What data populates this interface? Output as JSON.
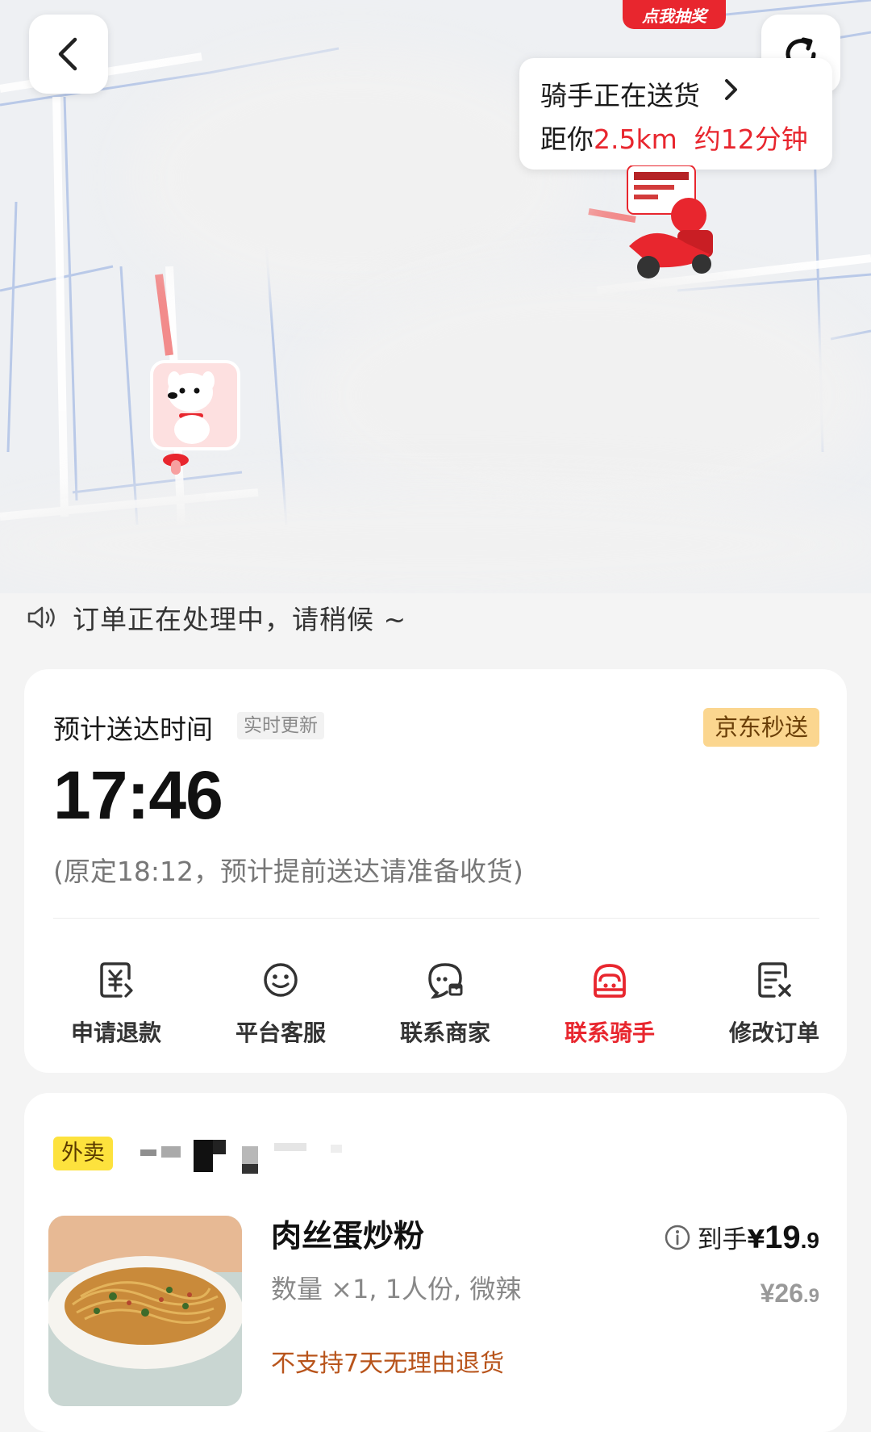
{
  "map": {
    "lottery_badge": "点我抽奖",
    "rider_bubble": {
      "status": "骑手正在送货",
      "distance_prefix": "距你",
      "distance": "2.5km",
      "eta_text": "约12分钟"
    }
  },
  "notice": {
    "text": "订单正在处理中，请稍候 ~"
  },
  "delivery": {
    "eta_label": "预计送达时间",
    "realtime_tag": "实时更新",
    "brand_tag": "京东秒送",
    "eta_time": "17:46",
    "eta_note": "(原定18:12，预计提前送达请准备收货)",
    "actions": [
      {
        "label": "申请退款",
        "icon": "refund-icon"
      },
      {
        "label": "平台客服",
        "icon": "customer-service-icon"
      },
      {
        "label": "联系商家",
        "icon": "contact-merchant-icon"
      },
      {
        "label": "联系骑手",
        "icon": "contact-rider-icon",
        "active": true
      },
      {
        "label": "修改订单",
        "icon": "edit-order-icon"
      }
    ]
  },
  "order": {
    "tag": "外卖",
    "item": {
      "name": "肉丝蛋炒粉",
      "spec": "数量 ×1, 1人份, 微辣",
      "policy": "不支持7天无理由退货",
      "price_prefix": "到手",
      "price_symbol": "¥",
      "price_int": "19",
      "price_dec": ".9",
      "orig_int": "¥26",
      "orig_dec": ".9"
    }
  },
  "colors": {
    "accent": "#e8262e",
    "brand_tag_bg": "#fbd68f",
    "waimai_tag_bg": "#fde23d"
  }
}
